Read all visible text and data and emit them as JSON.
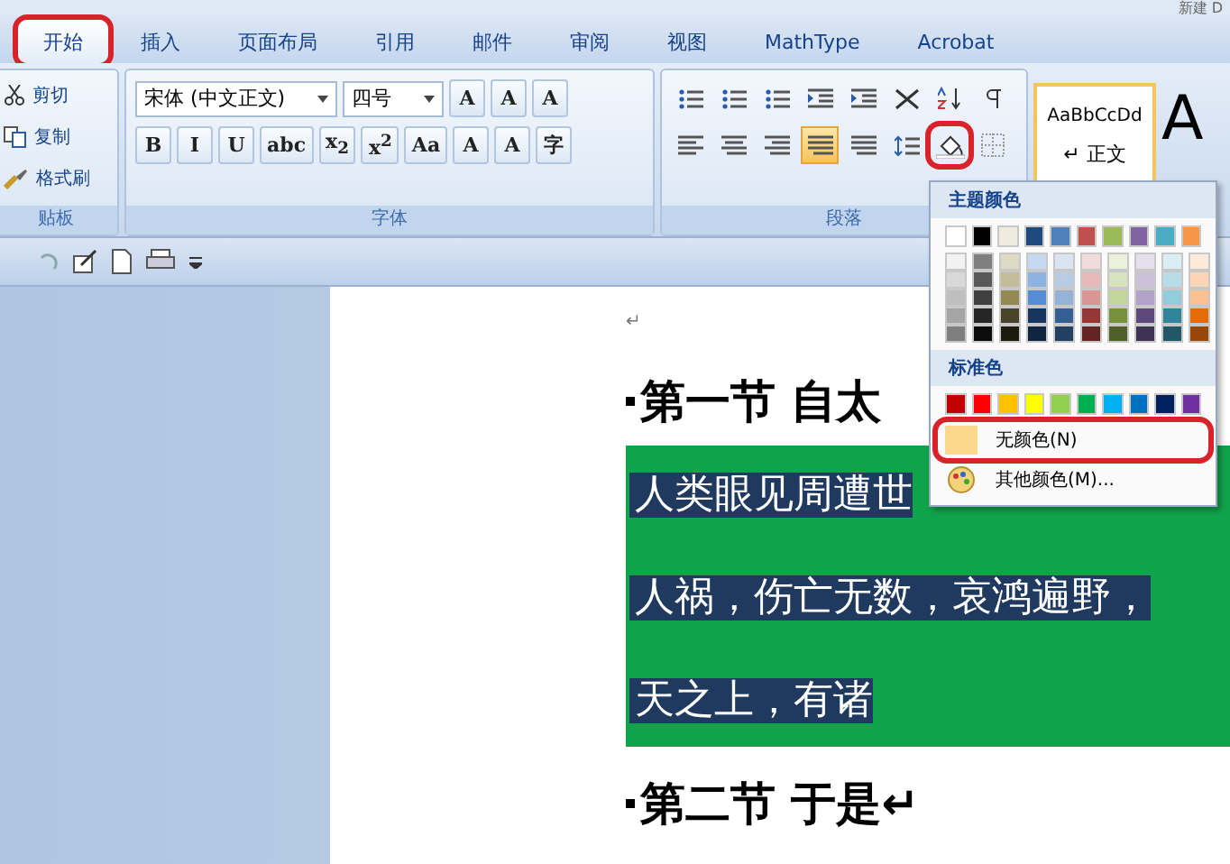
{
  "window": {
    "title": "新建 D"
  },
  "tabs": [
    {
      "label": "开始",
      "selected": true,
      "circled": true
    },
    {
      "label": "插入",
      "selected": false,
      "circled": false
    },
    {
      "label": "页面布局",
      "selected": false,
      "circled": false
    },
    {
      "label": "引用",
      "selected": false,
      "circled": false
    },
    {
      "label": "邮件",
      "selected": false,
      "circled": false
    },
    {
      "label": "审阅",
      "selected": false,
      "circled": false
    },
    {
      "label": "视图",
      "selected": false,
      "circled": false
    },
    {
      "label": "MathType",
      "selected": false,
      "circled": false
    },
    {
      "label": "Acrobat",
      "selected": false,
      "circled": false
    }
  ],
  "clipboard": {
    "items": [
      {
        "kind": "cut",
        "label": "剪切"
      },
      {
        "kind": "copy",
        "label": "复制"
      },
      {
        "kind": "brush",
        "label": "格式刷"
      }
    ],
    "group_label": "贴板"
  },
  "font": {
    "font_name": "宋体 (中文正文)",
    "font_size": "四号",
    "row1_buttons": [
      "A",
      "A",
      "A"
    ],
    "row2_buttons": [
      "B",
      "I",
      "U",
      "abc",
      "x$_{2}$",
      "x$^{2}$",
      "Aa",
      "A",
      "A",
      "字"
    ],
    "group_label": "字体"
  },
  "paragraph": {
    "row1": [
      {
        "kind": "bullets",
        "selected": false,
        "circled": false
      },
      {
        "kind": "numbering",
        "selected": false,
        "circled": false
      },
      {
        "kind": "multilevel",
        "selected": false,
        "circled": false
      },
      {
        "kind": "outdent",
        "selected": false,
        "circled": false
      },
      {
        "kind": "indent",
        "selected": false,
        "circled": false
      },
      {
        "kind": "asian",
        "selected": false,
        "circled": false
      },
      {
        "kind": "sort",
        "selected": false,
        "circled": false
      },
      {
        "kind": "marks",
        "selected": false,
        "circled": false
      }
    ],
    "row2": [
      {
        "kind": "left",
        "selected": false,
        "circled": false
      },
      {
        "kind": "center",
        "selected": false,
        "circled": false
      },
      {
        "kind": "right",
        "selected": false,
        "circled": false
      },
      {
        "kind": "justify",
        "selected": true,
        "circled": false
      },
      {
        "kind": "distribute",
        "selected": false,
        "circled": false
      },
      {
        "kind": "spacing",
        "selected": false,
        "circled": false
      },
      {
        "kind": "shading",
        "selected": false,
        "circled": true
      },
      {
        "kind": "borders",
        "selected": false,
        "circled": false
      }
    ],
    "group_label": "段落"
  },
  "styles": {
    "preview": "AaBbCcDd",
    "name": "↵ 正文",
    "next_preview": "A"
  },
  "shading_menu": {
    "theme_header": "主题颜色",
    "theme_colors": [
      {
        "color": "#ffffff",
        "shades": [
          {
            "color": "#f2f2f2"
          },
          {
            "color": "#d8d8d8"
          },
          {
            "color": "#bfbfbf"
          },
          {
            "color": "#a5a5a5"
          },
          {
            "color": "#7f7f7f"
          }
        ]
      },
      {
        "color": "#000000",
        "shades": [
          {
            "color": "#7f7f7f"
          },
          {
            "color": "#595959"
          },
          {
            "color": "#3f3f3f"
          },
          {
            "color": "#262626"
          },
          {
            "color": "#0c0c0c"
          }
        ]
      },
      {
        "color": "#eeece1",
        "shades": [
          {
            "color": "#ddd9c3"
          },
          {
            "color": "#c4bd97"
          },
          {
            "color": "#938953"
          },
          {
            "color": "#494429"
          },
          {
            "color": "#1d1b10"
          }
        ]
      },
      {
        "color": "#1f497d",
        "shades": [
          {
            "color": "#c6d9f0"
          },
          {
            "color": "#8db3e2"
          },
          {
            "color": "#548dd4"
          },
          {
            "color": "#17365d"
          },
          {
            "color": "#0f243e"
          }
        ]
      },
      {
        "color": "#4f81bd",
        "shades": [
          {
            "color": "#dbe5f1"
          },
          {
            "color": "#b8cce4"
          },
          {
            "color": "#95b3d7"
          },
          {
            "color": "#366092"
          },
          {
            "color": "#244061"
          }
        ]
      },
      {
        "color": "#c0504d",
        "shades": [
          {
            "color": "#f2dcdb"
          },
          {
            "color": "#e5b9b7"
          },
          {
            "color": "#d99694"
          },
          {
            "color": "#953734"
          },
          {
            "color": "#632423"
          }
        ]
      },
      {
        "color": "#9bbb59",
        "shades": [
          {
            "color": "#ebf1dd"
          },
          {
            "color": "#d7e3bc"
          },
          {
            "color": "#c3d69b"
          },
          {
            "color": "#76923c"
          },
          {
            "color": "#4f6128"
          }
        ]
      },
      {
        "color": "#8064a2",
        "shades": [
          {
            "color": "#e5e0ec"
          },
          {
            "color": "#ccc1d9"
          },
          {
            "color": "#b2a2c7"
          },
          {
            "color": "#5f497a"
          },
          {
            "color": "#3f3151"
          }
        ]
      },
      {
        "color": "#4bacc6",
        "shades": [
          {
            "color": "#dbeef3"
          },
          {
            "color": "#b7dde8"
          },
          {
            "color": "#92cddc"
          },
          {
            "color": "#31859b"
          },
          {
            "color": "#205867"
          }
        ]
      },
      {
        "color": "#f79646",
        "shades": [
          {
            "color": "#fdeada"
          },
          {
            "color": "#fbd5b5"
          },
          {
            "color": "#fac08f"
          },
          {
            "color": "#e36c09"
          },
          {
            "color": "#974806"
          }
        ]
      }
    ],
    "standard_header": "标准色",
    "standard_colors": [
      {
        "color": "#c00000"
      },
      {
        "color": "#ff0000"
      },
      {
        "color": "#ffc000"
      },
      {
        "color": "#ffff00"
      },
      {
        "color": "#92d050"
      },
      {
        "color": "#00b050"
      },
      {
        "color": "#00b0f0"
      },
      {
        "color": "#0070c0"
      },
      {
        "color": "#002060"
      },
      {
        "color": "#7030a0"
      }
    ],
    "items": [
      {
        "kind": "no_color",
        "label": "无颜色(N)",
        "circled": true
      },
      {
        "kind": "more",
        "label": "其他颜色(M)...",
        "circled": false
      }
    ]
  },
  "document": {
    "paragraph_mark": "↵",
    "blocks": [
      {
        "kind": "heading",
        "text": "第一节  自太"
      },
      {
        "kind": "shaded",
        "lines": [
          "人类眼见周遭世",
          "人祸，伤亡无数，哀鸿遍野，",
          "天之上，有诸"
        ]
      },
      {
        "kind": "heading",
        "text": "第二节  于是↵"
      }
    ]
  }
}
